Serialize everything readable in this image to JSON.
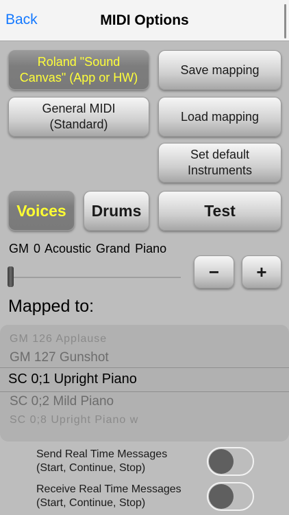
{
  "nav": {
    "back": "Back",
    "title": "MIDI Options"
  },
  "buttons": {
    "roland": "Roland \"Sound\nCanvas\" (App or HW)",
    "general_midi": "General MIDI\n(Standard)",
    "save_mapping": "Save mapping",
    "load_mapping": "Load mapping",
    "set_default": "Set default\nInstruments"
  },
  "tabs": {
    "voices": "Voices",
    "drums": "Drums",
    "test": "Test",
    "selected": "voices"
  },
  "instrument": {
    "label": "GM 0  Acoustic Grand Piano",
    "minus": "−",
    "plus": "+",
    "slider_value": 0
  },
  "mapped": {
    "title": "Mapped to:",
    "items": [
      "GM 126  Applause",
      "GM 127  Gunshot",
      "SC 0;1 Upright Piano",
      "SC 0;2 Mild Piano",
      "SC 0;8 Upright Piano w"
    ],
    "selected_index": 2
  },
  "toggles": {
    "send": {
      "label": "Send Real Time Messages\n(Start, Continue, Stop)",
      "on": false
    },
    "receive": {
      "label": "Receive Real Time Messages\n(Start, Continue, Stop)",
      "on": false
    }
  },
  "colors": {
    "accent_blue": "#1479ff",
    "selected_text": "#ffff3a"
  }
}
